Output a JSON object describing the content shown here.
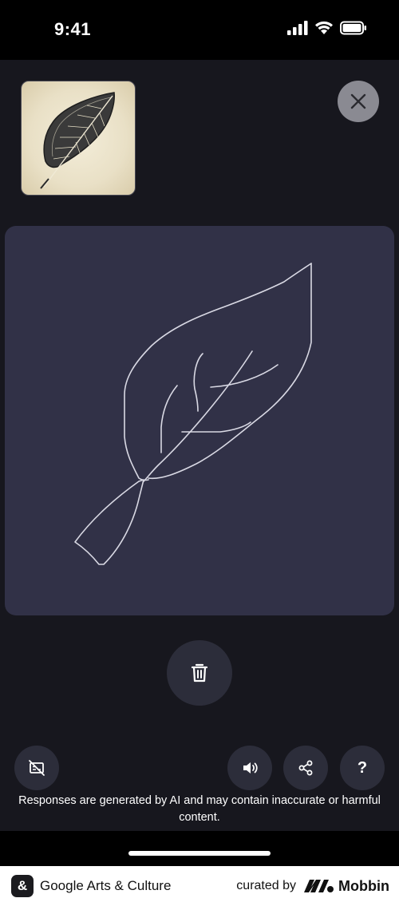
{
  "status_bar": {
    "time": "9:41"
  },
  "disclaimer": "Responses are generated by AI and may contain inaccurate or harmful content.",
  "footer": {
    "app_icon_glyph": "&",
    "app_name": "Google Arts & Culture",
    "curated_by": "curated by",
    "brand": "Mobbin"
  },
  "buttons": {
    "help_label": "?"
  },
  "icons": {
    "close": "close-icon",
    "delete": "trash-icon",
    "caption_off": "caption-off-icon",
    "audio": "speaker-icon",
    "share": "share-icon"
  },
  "colors": {
    "background": "#17171e",
    "canvas": "#313147",
    "button": "#2c2d3a",
    "stroke": "#d9d9e4"
  }
}
